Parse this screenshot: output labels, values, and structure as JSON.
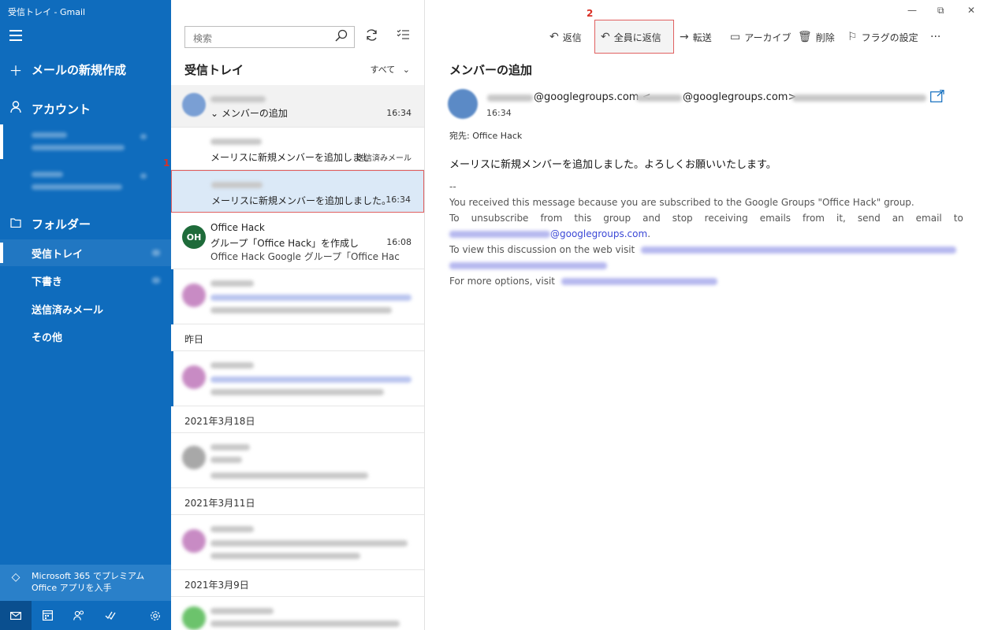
{
  "window": {
    "title": "受信トレイ - Gmail",
    "minimize": "—",
    "restore": "⧉",
    "close": "✕"
  },
  "nav": {
    "new_mail": "メールの新規作成",
    "accounts_label": "アカウント",
    "folders_label": "フォルダー",
    "folders": [
      {
        "label": "受信トレイ"
      },
      {
        "label": "下書き"
      },
      {
        "label": "送信済みメール"
      },
      {
        "label": "その他"
      }
    ],
    "promo": "Microsoft 365 でプレミアム Office アプリを入手"
  },
  "list": {
    "search_placeholder": "検索",
    "header": "受信トレイ",
    "filter": "すべて",
    "messages": [
      {
        "subject": "メンバーの追加",
        "time": "16:34"
      },
      {
        "preview": "メーリスに新規メンバーを追加しました。",
        "tag": "送信済みメール"
      },
      {
        "preview": "メーリスに新規メンバーを追加しました。よろしく",
        "time": "16:34"
      },
      {
        "avatar": "OH",
        "sender": "Office Hack",
        "subject": "グループ「Office Hack」を作成しました。いつで",
        "time": "16:08",
        "preview": "Office Hack Google グループ「Office Hack"
      }
    ],
    "day_separators": [
      "昨日",
      "2021年3月18日",
      "2021年3月11日",
      "2021年3月9日"
    ]
  },
  "callouts": {
    "one": "1",
    "two": "2"
  },
  "toolbar": {
    "reply": "返信",
    "reply_all": "全員に返信",
    "forward": "転送",
    "archive": "アーカイブ",
    "delete": "削除",
    "flag": "フラグの設定",
    "more": "···"
  },
  "email": {
    "subject": "メンバーの追加",
    "from_domain_1": "@googlegroups.com <",
    "from_domain_2": "@googlegroups.com>",
    "time": "16:34",
    "to": "宛先: Office Hack",
    "body_line1": "メーリスに新規メンバーを追加しました。よろしくお願いいたします。",
    "sig_sep": "--",
    "footer_1": "You received this message because you are subscribed to the Google Groups \"Office Hack\" group.",
    "footer_2_words": [
      "To",
      "unsubscribe",
      "from",
      "this",
      "group",
      "and",
      "stop",
      "receiving",
      "emails",
      "from",
      "it,",
      "send",
      "an",
      "email",
      "to"
    ],
    "footer_2_link": "@googlegroups.com",
    "footer_2_end": ".",
    "footer_3": "To view this discussion on the web visit",
    "footer_4": "For more options, visit"
  },
  "colors": {
    "nav_bg": "#0f6cbd",
    "accent": "#0f6cbd",
    "callout": "#d93025",
    "link": "#3b48d6"
  }
}
